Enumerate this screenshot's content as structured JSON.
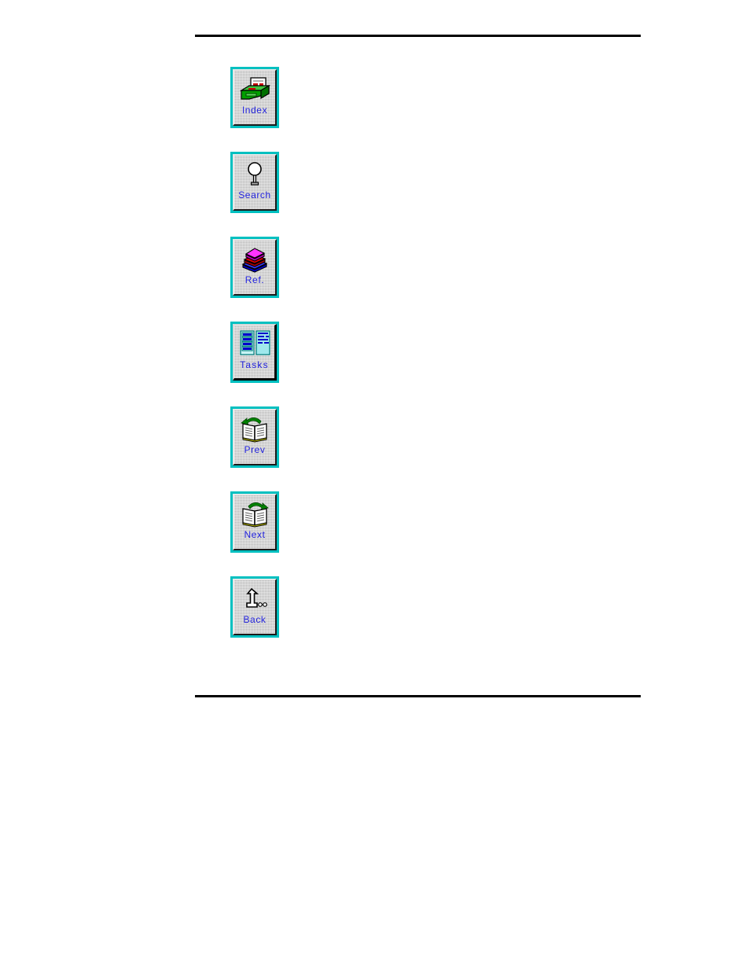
{
  "page": {
    "background_color": "#ffffff",
    "rule_color": "#000000",
    "label_color": "#2222dd",
    "button_face_color": "#b4b4b4",
    "button_highlight_color": "#00c0c0"
  },
  "rules": [
    {
      "name": "top-rule"
    },
    {
      "name": "bottom-rule"
    }
  ],
  "toolbar": {
    "name": "help-toolbar",
    "buttons": [
      {
        "label": "Index",
        "icon": "card-file-index-icon",
        "name": "index-button"
      },
      {
        "label": "Search",
        "icon": "magnifying-glass-icon",
        "name": "search-button"
      },
      {
        "label": "Ref.",
        "icon": "stacked-books-icon",
        "name": "reference-button"
      },
      {
        "label": "Tasks",
        "icon": "checklist-document-icon",
        "name": "tasks-button"
      },
      {
        "label": "Prev",
        "icon": "open-book-left-arrow-icon",
        "name": "prev-button"
      },
      {
        "label": "Next",
        "icon": "open-book-right-arrow-icon",
        "name": "next-button"
      },
      {
        "label": "Back",
        "icon": "curved-up-arrow-icon",
        "name": "back-button"
      }
    ]
  }
}
